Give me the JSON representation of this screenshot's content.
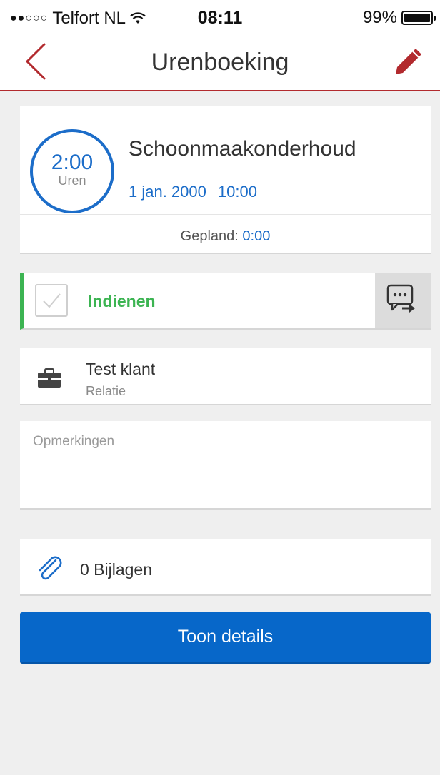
{
  "status_bar": {
    "signal": "●●○○○",
    "carrier": "Telfort NL",
    "time": "08:11",
    "battery": "99%"
  },
  "nav": {
    "title": "Urenboeking",
    "back_icon": "chevron-left-icon",
    "edit_icon": "pencil-icon",
    "accent_color": "#b22a2e"
  },
  "entry": {
    "hours": "2:00",
    "hours_unit": "Uren",
    "title": "Schoonmaakonderhoud",
    "date": "1 jan. 2000",
    "time": "10:00",
    "planned_label": "Gepland:",
    "planned_value": "0:00"
  },
  "submit": {
    "label": "Indienen",
    "checked": false,
    "color": "#3cb452",
    "comment_icon": "chat-forward-icon"
  },
  "relation": {
    "icon": "briefcase-icon",
    "name": "Test klant",
    "label": "Relatie"
  },
  "notes": {
    "placeholder": "Opmerkingen",
    "value": ""
  },
  "attachments": {
    "icon": "paperclip-icon",
    "label": "0 Bijlagen"
  },
  "details_button": {
    "label": "Toon details",
    "color": "#0767c9"
  }
}
